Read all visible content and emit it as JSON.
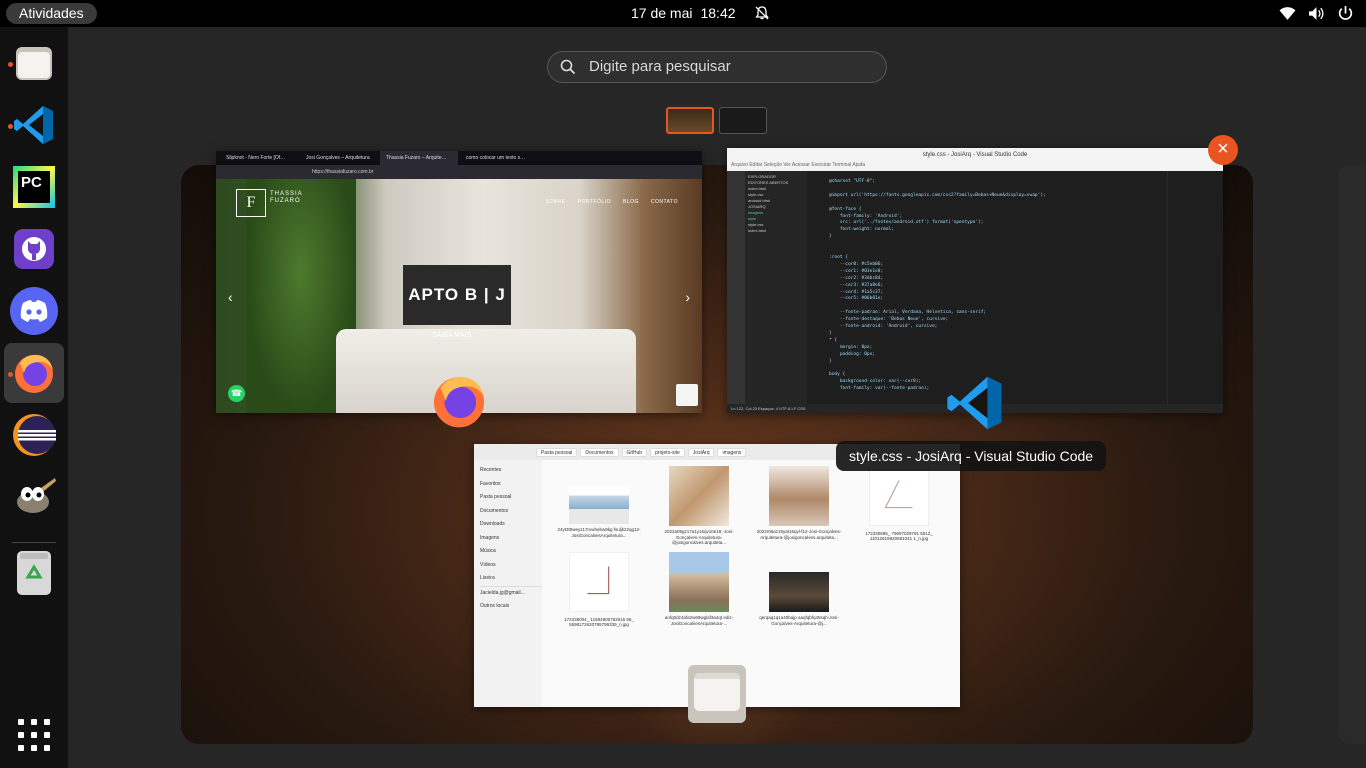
{
  "topbar": {
    "activities_label": "Atividades",
    "date": "17 de mai",
    "time": "18:42"
  },
  "dock": {
    "items": [
      {
        "name": "Files",
        "icon": "files-icon",
        "running": true
      },
      {
        "name": "Visual Studio Code",
        "icon": "vscode-icon",
        "running": true
      },
      {
        "name": "PyCharm",
        "icon": "pycharm-icon",
        "running": false
      },
      {
        "name": "GitHub Desktop",
        "icon": "github-icon",
        "running": false
      },
      {
        "name": "Discord",
        "icon": "discord-icon",
        "running": false
      },
      {
        "name": "Firefox",
        "icon": "firefox-icon",
        "running": true,
        "active": true
      },
      {
        "name": "Eclipse",
        "icon": "eclipse-icon",
        "running": false
      },
      {
        "name": "GIMP",
        "icon": "gimp-icon",
        "running": false
      },
      {
        "name": "Trash",
        "icon": "trash-icon",
        "running": false
      }
    ],
    "pycharm_label": "PC"
  },
  "search": {
    "placeholder": "Digite para pesquisar"
  },
  "firefox_window": {
    "tabs": [
      "Slipknot - Nero Forte [Of…",
      "Josi Gonçalves – Arquitetura",
      "Thassia Fuzaro – Arquite…",
      "como colocar um texto s…"
    ],
    "url": "https://thassiafuzaro.com.br",
    "logo_letter": "F",
    "brand_lines": [
      "THASSIA",
      "FUZARO"
    ],
    "nav": [
      "SOBRE",
      "PORTFÓLIO",
      "BLOG",
      "CONTATO"
    ],
    "hero_title": "APTO B | J",
    "hero_link": "SAIBA MAIS"
  },
  "vscode_window": {
    "title": "style.css - JosiArq - Visual Studio Code",
    "menu": "Arquivo  Editar  Seleção  Ver  Acessar  Executar  Terminal  Ajuda",
    "explorer": [
      "EXPLORADOR",
      "EDITORES ABERTOS",
      "index.html",
      "style.css",
      "android.html",
      "JOSIARQ",
      "imagens",
      "style",
      "style.css",
      "index.html"
    ],
    "code": "@charset \"UTF-8\";\n\n@import url('https://fonts.googleapis.com/css2?family=Bebas+Neue&display=swap');\n\n@font-face {\n    font-family: 'Android';\n    src: url('../fontes/android.otf') format('opentype');\n    font-weight: normal;\n}\n\n\n:root {\n    --cor0: #c5eb06;\n    --cor1: #03e1e8;\n    --cor2: #3dbc84;\n    --cor3: #37a8e6;\n    --cor4: #1a5c37;\n    --cor5: #06b01e;\n\n    --fonte-padrao: Arial, Verdana, Helvetica, sans-serif;\n    --fonte-destaque: 'Bebas Neue', cursive;\n    --fonte-android: 'Android', cursive;\n}\n* {\n    margin: 0px;\n    padding: 0px;\n}\n\nbody {\n    background-color: var(--cor0);\n    font-family: var(--fonte-padrao);",
    "status": "Ln 122, Col 23   Espaços: 4   UTF-8   LF   CSS"
  },
  "files_window": {
    "breadcrumbs": [
      "Pasta pessoal",
      "Documentos",
      "GitHub",
      "projeto-site",
      "JosiArq",
      "imagens"
    ],
    "sidebar": [
      "Recentes",
      "Favoritos",
      "Pasta pessoal",
      "Documentos",
      "Downloads",
      "Imagens",
      "Música",
      "Vídeos",
      "Lixeira",
      "Jacielda.jg@gmail...",
      "Outros locais"
    ],
    "files": [
      "24yt3t0weyz17rvwhebw9kg fsuljk22qg12-JosiGoncalvesArquitetura...",
      "2022a09gz17a1y16qv10e18 -Josi-Gonçalves-Arquitetura-@josigoncalves.arquiteta...",
      "2022r06az19yat16qvl-f12-Josi-Gonçalves-Arquitetura-@josigoncalves.arquiteta...",
      "172330695_ 79697029791 5012_ 11012619820681041 1_n.jpg",
      "172338004_ 11684906782916 59_ 5598172620795799339_n.jpg",
      "aofq0dz4afa2w69wglaf3a4qt ediz-JosiGoncalvesArquitetura-...",
      "qerqaq1q1a40bajp aaqfqbfq45sqh-Josi-Gonçalves-Arquitetura-@j..."
    ]
  },
  "tooltip": "style.css - JosiArq - Visual Studio Code",
  "colors": {
    "accent": "#e95420",
    "topbar": "#000000",
    "dock": "#111111"
  }
}
